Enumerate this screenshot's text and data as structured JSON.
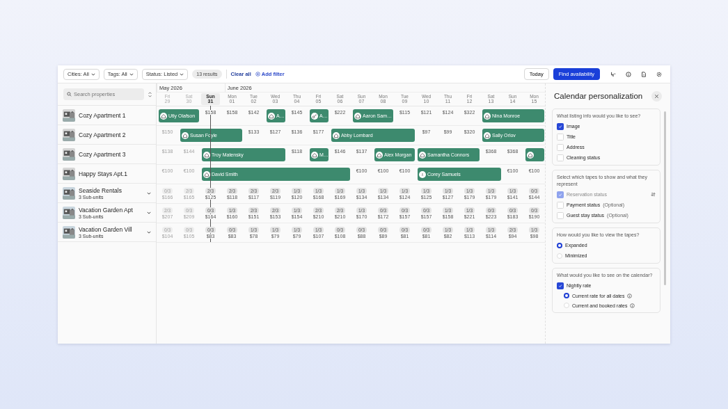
{
  "toolbar": {
    "filters": [
      {
        "label": "Cities: All"
      },
      {
        "label": "Tags: All"
      },
      {
        "label": "Status: Listed"
      }
    ],
    "results": "13 results",
    "clear": "Clear all",
    "add_filter": "Add filter",
    "today": "Today",
    "find": "Find availability"
  },
  "search": {
    "placeholder": "Search properties"
  },
  "months": [
    {
      "label": "May 2026",
      "days": [
        {
          "weekday": "Fri",
          "date": "29",
          "past": true,
          "today": false
        },
        {
          "weekday": "Sat",
          "date": "30",
          "past": true,
          "today": false
        },
        {
          "weekday": "Sun",
          "date": "31",
          "past": false,
          "today": true
        }
      ]
    },
    {
      "label": "June 2026",
      "days": [
        {
          "weekday": "Mon",
          "date": "01",
          "past": false,
          "today": false
        },
        {
          "weekday": "Tue",
          "date": "02",
          "past": false,
          "today": false
        },
        {
          "weekday": "Wed",
          "date": "03",
          "past": false,
          "today": false
        },
        {
          "weekday": "Thu",
          "date": "04",
          "past": false,
          "today": false
        },
        {
          "weekday": "Fri",
          "date": "05",
          "past": false,
          "today": false
        },
        {
          "weekday": "Sat",
          "date": "06",
          "past": false,
          "today": false
        },
        {
          "weekday": "Sun",
          "date": "07",
          "past": false,
          "today": false
        },
        {
          "weekday": "Mon",
          "date": "08",
          "past": false,
          "today": false
        },
        {
          "weekday": "Tue",
          "date": "09",
          "past": false,
          "today": false
        },
        {
          "weekday": "Wed",
          "date": "10",
          "past": false,
          "today": false
        },
        {
          "weekday": "Thu",
          "date": "11",
          "past": false,
          "today": false
        },
        {
          "weekday": "Fri",
          "date": "12",
          "past": false,
          "today": false
        },
        {
          "weekday": "Sat",
          "date": "13",
          "past": false,
          "today": false
        },
        {
          "weekday": "Sun",
          "date": "14",
          "past": false,
          "today": false
        },
        {
          "weekday": "Mon",
          "date": "15",
          "past": false,
          "today": false
        }
      ]
    }
  ],
  "properties": [
    {
      "name": "Cozy Apartment 1",
      "kind": "single",
      "expandable": false,
      "cells": [
        {
          "kind": "house",
          "guest": "Utly Olafson"
        },
        {
          "kind": "stay"
        },
        {
          "kind": "price",
          "text": "$158"
        },
        {
          "kind": "price",
          "text": "$158"
        },
        {
          "kind": "price",
          "text": "$142"
        },
        {
          "kind": "house",
          "guest": "A…"
        },
        {
          "kind": "price",
          "text": "$145"
        },
        {
          "kind": "key",
          "guest": "A…"
        },
        {
          "kind": "price",
          "text": "$222"
        },
        {
          "kind": "house",
          "guest": "Aaron Sam…"
        },
        {
          "kind": "stay"
        },
        {
          "kind": "price",
          "text": "$115"
        },
        {
          "kind": "price",
          "text": "$121"
        },
        {
          "kind": "price",
          "text": "$124"
        },
        {
          "kind": "price",
          "text": "$322"
        },
        {
          "kind": "house",
          "guest": "Nina Monroe"
        },
        {
          "kind": "stay"
        },
        {
          "kind": "stay"
        }
      ]
    },
    {
      "name": "Cozy Apartment 2",
      "kind": "single",
      "expandable": false,
      "cells": [
        {
          "kind": "price",
          "text": "$150"
        },
        {
          "kind": "house",
          "guest": "Susan Foyle"
        },
        {
          "kind": "stay"
        },
        {
          "kind": "stay"
        },
        {
          "kind": "price",
          "text": "$133"
        },
        {
          "kind": "price",
          "text": "$127"
        },
        {
          "kind": "price",
          "text": "$136"
        },
        {
          "kind": "price",
          "text": "$177"
        },
        {
          "kind": "house",
          "guest": "Abby Lombard"
        },
        {
          "kind": "stay"
        },
        {
          "kind": "stay"
        },
        {
          "kind": "stay"
        },
        {
          "kind": "price",
          "text": "$97"
        },
        {
          "kind": "price",
          "text": "$99"
        },
        {
          "kind": "price",
          "text": "$320"
        },
        {
          "kind": "house",
          "guest": "Sally Orlov"
        },
        {
          "kind": "stay"
        },
        {
          "kind": "stay"
        }
      ]
    },
    {
      "name": "Cozy Apartment 3",
      "kind": "single",
      "expandable": false,
      "cells": [
        {
          "kind": "price",
          "text": "$138"
        },
        {
          "kind": "price",
          "text": "$144"
        },
        {
          "kind": "house",
          "guest": "Troy Matensky"
        },
        {
          "kind": "stay"
        },
        {
          "kind": "stay"
        },
        {
          "kind": "stay"
        },
        {
          "kind": "price",
          "text": "$118"
        },
        {
          "kind": "house",
          "guest": "M…"
        },
        {
          "kind": "price",
          "text": "$146"
        },
        {
          "kind": "price",
          "text": "$137"
        },
        {
          "kind": "house",
          "guest": "Alex Morgan"
        },
        {
          "kind": "stay"
        },
        {
          "kind": "house",
          "guest": "Samantha Connors"
        },
        {
          "kind": "stay"
        },
        {
          "kind": "stay"
        },
        {
          "kind": "price",
          "text": "$368"
        },
        {
          "kind": "price",
          "text": "$368"
        },
        {
          "kind": "house"
        }
      ]
    },
    {
      "name": "Happy Stays Apt.1",
      "kind": "single",
      "expandable": false,
      "cells": [
        {
          "kind": "price",
          "text": "€100"
        },
        {
          "kind": "price",
          "text": "€100"
        },
        {
          "kind": "house",
          "guest": "David Smith"
        },
        {
          "kind": "stay"
        },
        {
          "kind": "stay"
        },
        {
          "kind": "stay"
        },
        {
          "kind": "stay"
        },
        {
          "kind": "stay"
        },
        {
          "kind": "stay"
        },
        {
          "kind": "price",
          "text": "€100"
        },
        {
          "kind": "price",
          "text": "€100"
        },
        {
          "kind": "price",
          "text": "€100"
        },
        {
          "kind": "guest",
          "guest": "Corey Samuels"
        },
        {
          "kind": "stay"
        },
        {
          "kind": "stay"
        },
        {
          "kind": "stay"
        },
        {
          "kind": "price",
          "text": "€100"
        },
        {
          "kind": "price",
          "text": "€100"
        }
      ]
    },
    {
      "name": "Seaside Rentals",
      "kind": "multi",
      "subunits": "3 Sub-units",
      "expandable": true,
      "cells": [
        {
          "occupancy": "0/3",
          "price": "$166"
        },
        {
          "occupancy": "2/3",
          "price": "$165"
        },
        {
          "occupancy": "2/3",
          "price": "$125"
        },
        {
          "occupancy": "2/3",
          "price": "$118"
        },
        {
          "occupancy": "2/3",
          "price": "$117"
        },
        {
          "occupancy": "2/3",
          "price": "$119"
        },
        {
          "occupancy": "1/3",
          "price": "$120"
        },
        {
          "occupancy": "1/3",
          "price": "$168"
        },
        {
          "occupancy": "1/3",
          "price": "$169"
        },
        {
          "occupancy": "1/3",
          "price": "$134"
        },
        {
          "occupancy": "1/3",
          "price": "$134"
        },
        {
          "occupancy": "1/3",
          "price": "$124"
        },
        {
          "occupancy": "1/3",
          "price": "$125"
        },
        {
          "occupancy": "1/3",
          "price": "$127"
        },
        {
          "occupancy": "1/3",
          "price": "$179"
        },
        {
          "occupancy": "1/3",
          "price": "$179"
        },
        {
          "occupancy": "1/3",
          "price": "$141"
        },
        {
          "occupancy": "0/3",
          "price": "$144"
        }
      ]
    },
    {
      "name": "Vacation Garden Apt",
      "kind": "multi",
      "subunits": "3 Sub-units",
      "expandable": true,
      "cells": [
        {
          "occupancy": "2/3",
          "price": "$207"
        },
        {
          "occupancy": "0/3",
          "price": "$209"
        },
        {
          "occupancy": "0/3",
          "price": "$164"
        },
        {
          "occupancy": "1/3",
          "price": "$160"
        },
        {
          "occupancy": "2/3",
          "price": "$151"
        },
        {
          "occupancy": "2/3",
          "price": "$153"
        },
        {
          "occupancy": "1/3",
          "price": "$154"
        },
        {
          "occupancy": "2/3",
          "price": "$210"
        },
        {
          "occupancy": "2/3",
          "price": "$210"
        },
        {
          "occupancy": "1/3",
          "price": "$170"
        },
        {
          "occupancy": "0/3",
          "price": "$172"
        },
        {
          "occupancy": "0/3",
          "price": "$157"
        },
        {
          "occupancy": "0/3",
          "price": "$157"
        },
        {
          "occupancy": "1/3",
          "price": "$158"
        },
        {
          "occupancy": "1/3",
          "price": "$221"
        },
        {
          "occupancy": "0/3",
          "price": "$223"
        },
        {
          "occupancy": "0/3",
          "price": "$183"
        },
        {
          "occupancy": "0/3",
          "price": "$190"
        }
      ]
    },
    {
      "name": "Vacation Garden Vill",
      "kind": "multi",
      "subunits": "3 Sub-units",
      "expandable": true,
      "cells": [
        {
          "occupancy": "0/3",
          "price": "$104"
        },
        {
          "occupancy": "0/3",
          "price": "$105"
        },
        {
          "occupancy": "0/3",
          "price": "$83"
        },
        {
          "occupancy": "0/3",
          "price": "$83"
        },
        {
          "occupancy": "1/3",
          "price": "$78"
        },
        {
          "occupancy": "1/3",
          "price": "$79"
        },
        {
          "occupancy": "1/3",
          "price": "$79"
        },
        {
          "occupancy": "1/3",
          "price": "$107"
        },
        {
          "occupancy": "0/3",
          "price": "$108"
        },
        {
          "occupancy": "0/3",
          "price": "$88"
        },
        {
          "occupancy": "0/3",
          "price": "$89"
        },
        {
          "occupancy": "0/3",
          "price": "$81"
        },
        {
          "occupancy": "0/3",
          "price": "$81"
        },
        {
          "occupancy": "1/3",
          "price": "$82"
        },
        {
          "occupancy": "1/3",
          "price": "$113"
        },
        {
          "occupancy": "1/3",
          "price": "$114"
        },
        {
          "occupancy": "2/3",
          "price": "$94"
        },
        {
          "occupancy": "1/3",
          "price": "$98"
        }
      ]
    }
  ],
  "panel": {
    "title": "Calendar personalization",
    "sections": [
      {
        "kind": "checkboxes",
        "question": "What listing info would you like to see?",
        "options": [
          {
            "label": "Image",
            "checked": true
          },
          {
            "label": "Title",
            "checked": false
          },
          {
            "label": "Address",
            "checked": false
          },
          {
            "label": "Cleaning status",
            "checked": false
          }
        ]
      },
      {
        "kind": "checkboxes",
        "question": "Select which tapes to show and what they represent",
        "options": [
          {
            "label": "Reservation status",
            "checked": true,
            "disabled": true,
            "adjustable": true
          },
          {
            "label": "Payment status",
            "note": "(Optional)",
            "checked": false,
            "disabled": false,
            "adjustable": false
          },
          {
            "label": "Guest stay status",
            "note": "(Optional)",
            "checked": false,
            "disabled": false,
            "adjustable": false
          }
        ]
      },
      {
        "kind": "radios",
        "question": "How would you like to view the tapes?",
        "options": [
          {
            "label": "Expanded",
            "selected": true
          },
          {
            "label": "Minimized",
            "selected": false
          }
        ]
      },
      {
        "kind": "checkboxes",
        "question": "What would you like to see on the calendar?",
        "options": [
          {
            "label": "Nightly rate",
            "checked": true,
            "children": [
              {
                "label": "Current rate for all dates",
                "selected": true
              },
              {
                "label": "Current and booked rates",
                "selected": false
              }
            ]
          }
        ]
      }
    ]
  }
}
